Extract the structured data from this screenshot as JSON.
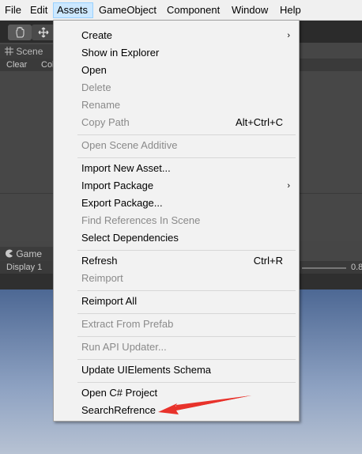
{
  "menubar": {
    "items": [
      "File",
      "Edit",
      "Assets",
      "GameObject",
      "Component",
      "Window",
      "Help"
    ],
    "active": "Assets"
  },
  "editor": {
    "scene_tab": "Scene",
    "scene_toolbar": [
      "Clear",
      "Col"
    ],
    "game_tab": "Game",
    "game_display": "Display 1",
    "game_scale_value": "0.8"
  },
  "icons": {
    "hand_tool": "hand-icon",
    "move_tool": "move-icon",
    "scene_tab": "grid-icon",
    "game_tab": "pacman-icon",
    "submenu": "chevron-right-icon"
  },
  "menu": {
    "create": "Create",
    "show_in_explorer": "Show in Explorer",
    "open": "Open",
    "delete": "Delete",
    "rename": "Rename",
    "copy_path": "Copy Path",
    "copy_path_shortcut": "Alt+Ctrl+C",
    "open_scene_additive": "Open Scene Additive",
    "import_new_asset": "Import New Asset...",
    "import_package": "Import Package",
    "export_package": "Export Package...",
    "find_references": "Find References In Scene",
    "select_dependencies": "Select Dependencies",
    "refresh": "Refresh",
    "refresh_shortcut": "Ctrl+R",
    "reimport": "Reimport",
    "reimport_all": "Reimport All",
    "extract_from_prefab": "Extract From Prefab",
    "run_api_updater": "Run API Updater...",
    "update_uielements": "Update UIElements Schema",
    "open_csharp_project": "Open C# Project",
    "search_refrence": "SearchRefrence"
  },
  "colors": {
    "menu_highlight": "#cce8ff",
    "annotation_arrow": "#e8322b",
    "disabled_text": "#8a8a8a"
  }
}
